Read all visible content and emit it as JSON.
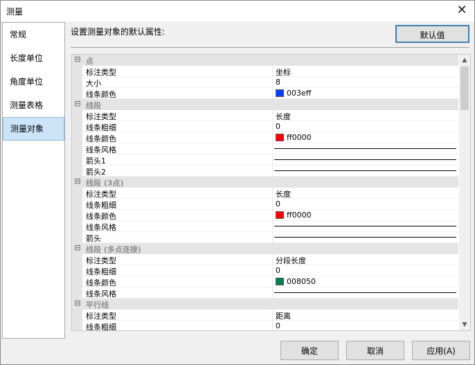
{
  "window": {
    "title": "测量"
  },
  "sidebar": {
    "items": [
      {
        "label": "常规",
        "active": false
      },
      {
        "label": "长度单位",
        "active": false
      },
      {
        "label": "角度单位",
        "active": false
      },
      {
        "label": "测量表格",
        "active": false
      },
      {
        "label": "测量对象",
        "active": true
      }
    ]
  },
  "main": {
    "heading": "设置测量对象的默认属性:",
    "defaults_button": "默认值",
    "grid": [
      {
        "type": "category",
        "label": "点"
      },
      {
        "type": "prop",
        "name": "标注类型",
        "value": "坐标"
      },
      {
        "type": "prop",
        "name": "大小",
        "value": "8"
      },
      {
        "type": "prop",
        "name": "线条颜色",
        "value": "003eff",
        "color": "#003eff"
      },
      {
        "type": "category",
        "label": "线段"
      },
      {
        "type": "prop",
        "name": "标注类型",
        "value": "长度"
      },
      {
        "type": "prop",
        "name": "线条粗细",
        "value": "0"
      },
      {
        "type": "prop",
        "name": "线条颜色",
        "value": "ff0000",
        "color": "#ff0000"
      },
      {
        "type": "prop",
        "name": "线条风格",
        "line": true
      },
      {
        "type": "prop",
        "name": "箭头1",
        "line": true
      },
      {
        "type": "prop",
        "name": "箭头2",
        "line": true
      },
      {
        "type": "category",
        "label": "线段 (3点)"
      },
      {
        "type": "prop",
        "name": "标注类型",
        "value": "长度"
      },
      {
        "type": "prop",
        "name": "线条粗细",
        "value": "0"
      },
      {
        "type": "prop",
        "name": "线条颜色",
        "value": "ff0000",
        "color": "#ff0000"
      },
      {
        "type": "prop",
        "name": "线条风格",
        "line": true
      },
      {
        "type": "prop",
        "name": "箭头",
        "line": true
      },
      {
        "type": "category",
        "label": "线段 (多点连接)"
      },
      {
        "type": "prop",
        "name": "标注类型",
        "value": "分段长度"
      },
      {
        "type": "prop",
        "name": "线条粗细",
        "value": "0"
      },
      {
        "type": "prop",
        "name": "线条颜色",
        "value": "008050",
        "color": "#008050"
      },
      {
        "type": "prop",
        "name": "线条风格",
        "line": true
      },
      {
        "type": "category",
        "label": "平行线"
      },
      {
        "type": "prop",
        "name": "标注类型",
        "value": "距离"
      },
      {
        "type": "prop",
        "name": "线条粗细",
        "value": "0"
      }
    ]
  },
  "footer": {
    "ok": "确定",
    "cancel": "取消",
    "apply": "应用(A)"
  }
}
